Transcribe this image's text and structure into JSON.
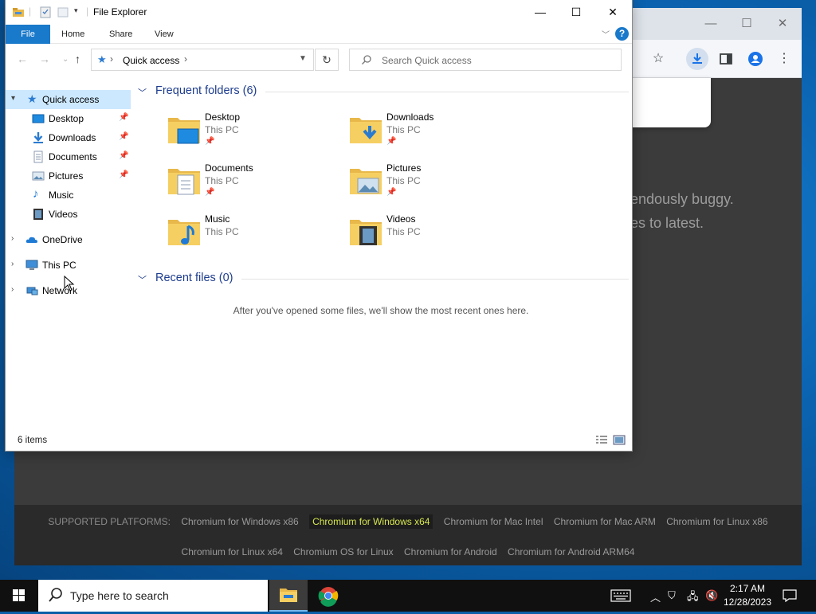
{
  "explorer": {
    "title": "File Explorer",
    "ribbon_tabs": [
      "File",
      "Home",
      "Share",
      "View"
    ],
    "help": "?",
    "address": {
      "location": "Quick access"
    },
    "search": {
      "placeholder": "Search Quick access"
    },
    "nav": {
      "quick_access": "Quick access",
      "items": [
        "Desktop",
        "Downloads",
        "Documents",
        "Pictures",
        "Music",
        "Videos"
      ],
      "onedrive": "OneDrive",
      "this_pc": "This PC",
      "network": "Network"
    },
    "frequent_title": "Frequent folders (6)",
    "folders": [
      {
        "name": "Desktop",
        "location": "This PC",
        "pinned": true
      },
      {
        "name": "Downloads",
        "location": "This PC",
        "pinned": true
      },
      {
        "name": "Documents",
        "location": "This PC",
        "pinned": true
      },
      {
        "name": "Pictures",
        "location": "This PC",
        "pinned": true
      },
      {
        "name": "Music",
        "location": "This PC",
        "pinned": false
      },
      {
        "name": "Videos",
        "location": "This PC",
        "pinned": false
      }
    ],
    "recent_title": "Recent files (0)",
    "recent_empty": "After you've opened some files, we'll show the most recent ones here.",
    "status": "6 items"
  },
  "chrome": {
    "bg_text_1": "endously buggy.",
    "bg_text_2": "es to latest.",
    "footer_label": "SUPPORTED PLATFORMS:",
    "platforms_row1": [
      "Chromium for Windows x86",
      "Chromium for Windows x64",
      "Chromium for Mac Intel",
      "Chromium for Mac ARM",
      "Chromium for Linux x86"
    ],
    "platforms_row2": [
      "Chromium for Linux x64",
      "Chromium OS for Linux",
      "Chromium for Android",
      "Chromium for Android ARM64"
    ],
    "highlight_color": "#d6e64e"
  },
  "taskbar": {
    "search_placeholder": "Type here to search",
    "time": "2:17 AM",
    "date": "12/28/2023"
  }
}
